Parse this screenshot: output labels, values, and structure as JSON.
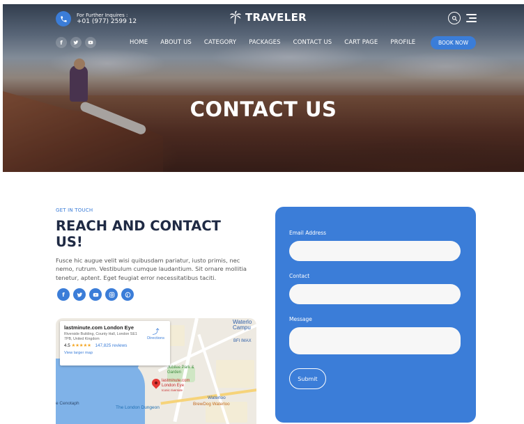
{
  "header": {
    "contact_label": "For Further Inquires :",
    "contact_phone": "+01 (977) 2599 12",
    "logo_text": "TRAVELER",
    "nav": [
      "HOME",
      "ABOUT US",
      "CATEGORY",
      "PACKAGES",
      "CONTACT US",
      "CART PAGE",
      "PROFILE"
    ],
    "book_now": "BOOK NOW",
    "social_icons": [
      "facebook-icon",
      "twitter-icon",
      "youtube-icon"
    ]
  },
  "hero": {
    "title": "CONTACT US"
  },
  "contact": {
    "eyebrow": "GET IN TOUCH",
    "heading": "REACH AND CONTACT US!",
    "paragraph": "Fusce hic augue velit wisi quibusdam pariatur, iusto primis, nec nemo, rutrum. Vestibulum cumque laudantium. Sit ornare mollitia tenetur, aptent. Eget feugiat error necessitatibus taciti.",
    "social_icons": [
      "facebook-icon",
      "twitter-icon",
      "youtube-icon",
      "instagram-icon",
      "pinterest-icon"
    ]
  },
  "map": {
    "place_name": "lastminute.com London Eye",
    "address": "Riverside Building, County Hall, London SE1 7PB, United Kingdom",
    "rating": "4.5",
    "stars": "★★★★★",
    "reviews": "147,825 reviews",
    "larger_map": "View larger map",
    "directions": "Directions",
    "labels": {
      "waterloo_campus": "Waterlo Campu",
      "bfi_imax": "BFI IMAX",
      "jubilee": "Jubilee Park & Garden",
      "pin_label": "lastminute.com London Eye",
      "pin_sub": "Iconic riverside",
      "waterloo": "Waterloo",
      "brewdog": "BrewDog Waterloo",
      "cenotaph": "e Cenotaph",
      "dungeon": "The London Dungeon"
    }
  },
  "form": {
    "email_label": "Email Address",
    "contact_label": "Contact",
    "message_label": "Message",
    "email_value": "",
    "contact_value": "",
    "message_value": "",
    "submit": "Submit"
  },
  "colors": {
    "accent": "#3b7dd8",
    "heading": "#1f2a44"
  }
}
